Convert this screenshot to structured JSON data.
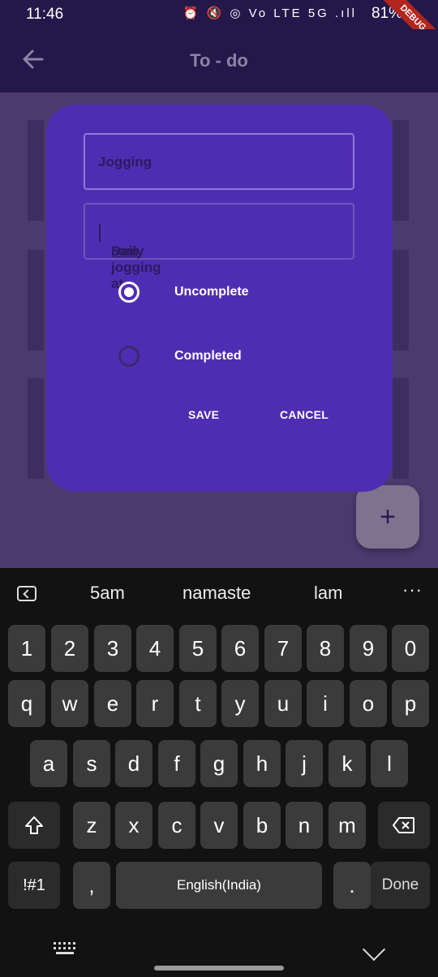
{
  "status_bar": {
    "time": "11:46",
    "icons": "⏰ 🔇 ◎ Vo LTE 5G .ıll",
    "battery": "81%",
    "debug": "DEBUG"
  },
  "app_bar": {
    "title": "To - do",
    "back_icon": "arrow-back-icon"
  },
  "fab": {
    "label": "+"
  },
  "dialog": {
    "title_field_value": "Jogging",
    "desc_field_prefix": "Daily jogging at ",
    "desc_field_underlined": "5am",
    "radio_uncomplete": "Uncomplete",
    "radio_completed": "Completed",
    "selected": "Uncomplete",
    "save_label": "SAVE",
    "cancel_label": "CANCEL"
  },
  "keyboard": {
    "suggestions": [
      "5am",
      "namaste",
      "lam"
    ],
    "more": "···",
    "row_numbers": [
      "1",
      "2",
      "3",
      "4",
      "5",
      "6",
      "7",
      "8",
      "9",
      "0"
    ],
    "row_q": [
      "q",
      "w",
      "e",
      "r",
      "t",
      "y",
      "u",
      "i",
      "o",
      "p"
    ],
    "row_a": [
      "a",
      "s",
      "d",
      "f",
      "g",
      "h",
      "j",
      "k",
      "l"
    ],
    "row_z": [
      "z",
      "x",
      "c",
      "v",
      "b",
      "n",
      "m"
    ],
    "symbols_label": "!#1",
    "comma": ",",
    "space_label": "English(India)",
    "period": ".",
    "done_label": "Done"
  },
  "colors": {
    "accent": "#4f2db3",
    "appbar": "#24184a"
  }
}
